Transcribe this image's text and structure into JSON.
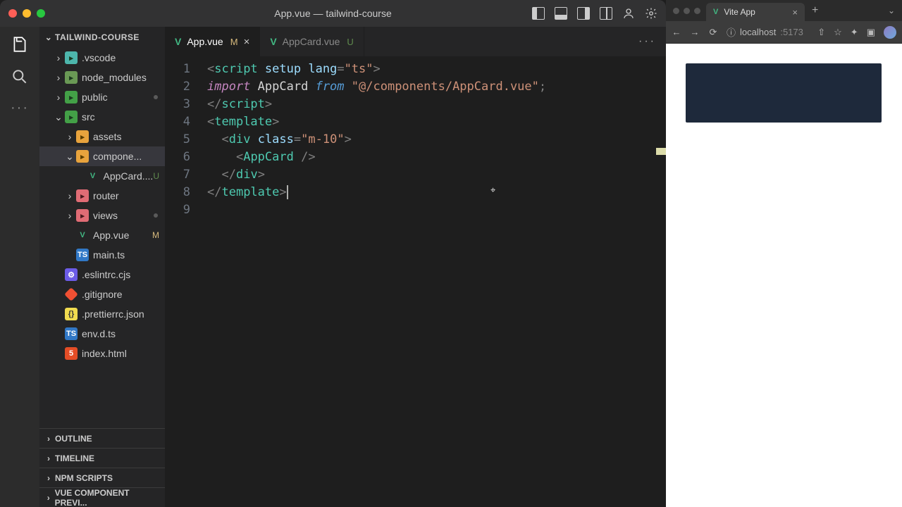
{
  "window": {
    "title": "App.vue — tailwind-course"
  },
  "explorer": {
    "root": "TAILWIND-COURSE",
    "items": [
      {
        "name": ".vscode",
        "type": "folder",
        "iconClass": "teal"
      },
      {
        "name": "node_modules",
        "type": "folder",
        "iconClass": "gray"
      },
      {
        "name": "public",
        "type": "folder",
        "iconClass": "folder-icon",
        "statusDot": true
      },
      {
        "name": "src",
        "type": "folder",
        "iconClass": "folder-icon",
        "expanded": true
      },
      {
        "name": "assets",
        "type": "folder",
        "iconClass": "orange",
        "indent": 2
      },
      {
        "name": "compone...",
        "type": "folder",
        "iconClass": "orange",
        "indent": 2,
        "expanded": true,
        "selected": true
      },
      {
        "name": "AppCard....",
        "type": "file",
        "iconClass": "vue",
        "indent": 3,
        "status": "U"
      },
      {
        "name": "router",
        "type": "folder",
        "iconClass": "red",
        "indent": 2
      },
      {
        "name": "views",
        "type": "folder",
        "iconClass": "red",
        "indent": 2,
        "statusDot": true
      },
      {
        "name": "App.vue",
        "type": "file",
        "iconClass": "vue",
        "indent": 2,
        "status": "M"
      },
      {
        "name": "main.ts",
        "type": "file",
        "iconClass": "ts",
        "indent": 2
      },
      {
        "name": ".eslintrc.cjs",
        "type": "file",
        "iconClass": "config",
        "indent": 1
      },
      {
        "name": ".gitignore",
        "type": "file",
        "iconClass": "git",
        "indent": 1
      },
      {
        "name": ".prettierrc.json",
        "type": "file",
        "iconClass": "json",
        "indent": 1
      },
      {
        "name": "env.d.ts",
        "type": "file",
        "iconClass": "ts",
        "indent": 1
      },
      {
        "name": "index.html",
        "type": "file",
        "iconClass": "html",
        "indent": 1
      }
    ],
    "panels": [
      "OUTLINE",
      "TIMELINE",
      "NPM SCRIPTS",
      "VUE COMPONENT PREVI..."
    ]
  },
  "tabs": [
    {
      "name": "App.vue",
      "status": "M",
      "active": true
    },
    {
      "name": "AppCard.vue",
      "status": "U",
      "active": false
    }
  ],
  "code": {
    "lines": [
      {
        "n": "1",
        "html": "<span class='tok-punc'>&lt;</span><span class='tok-tag'>script</span> <span class='tok-attr'>setup</span> <span class='tok-attr'>lang</span><span class='tok-punc'>=</span><span class='tok-str'>\"ts\"</span><span class='tok-punc'>&gt;</span>"
      },
      {
        "n": "2",
        "html": "<span class='tok-kw'>import</span> <span class='tok-name'>AppCard</span> <span class='tok-kw2'>from</span> <span class='tok-str'>\"@/components/AppCard.vue\"</span><span class='tok-punc'>;</span>"
      },
      {
        "n": "3",
        "html": "<span class='tok-punc'>&lt;/</span><span class='tok-tag'>script</span><span class='tok-punc'>&gt;</span>"
      },
      {
        "n": "4",
        "html": "<span class='tok-punc'>&lt;</span><span class='tok-tag'>template</span><span class='tok-punc'>&gt;</span>"
      },
      {
        "n": "5",
        "html": "  <span class='tok-punc'>&lt;</span><span class='tok-tag'>div</span> <span class='tok-attr'>class</span><span class='tok-punc'>=</span><span class='tok-str'>\"m-10\"</span><span class='tok-punc'>&gt;</span>"
      },
      {
        "n": "6",
        "html": "    <span class='tok-punc'>&lt;</span><span class='tok-comp'>AppCard</span> <span class='tok-punc'>/&gt;</span>"
      },
      {
        "n": "7",
        "html": "  <span class='tok-punc'>&lt;/</span><span class='tok-tag'>div</span><span class='tok-punc'>&gt;</span>"
      },
      {
        "n": "8",
        "html": "<span class='tok-punc'>&lt;/</span><span class='tok-tag'>template</span><span class='tok-punc'>&gt;</span><span class='cursor-bar'></span>"
      },
      {
        "n": "9",
        "html": ""
      }
    ]
  },
  "browser": {
    "tabTitle": "Vite App",
    "url_host": "localhost",
    "url_port": ":5173"
  }
}
